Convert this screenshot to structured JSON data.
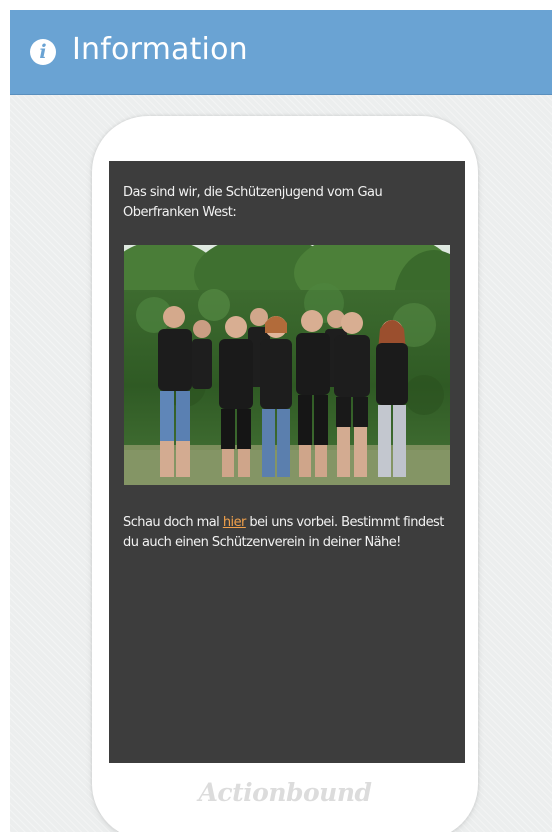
{
  "header": {
    "icon": "info-icon",
    "title": "Information",
    "color": "#6aa3d3"
  },
  "content": {
    "intro": "Das sind wir, die Schützenjugend vom Gau Oberfranken West:",
    "photo_icon": "group-photo",
    "outro_before": "Schau doch mal ",
    "link_label": "hier",
    "outro_after": " bei uns vorbei. Bestimmt findest du auch einen Schützenverein in deiner Nähe!",
    "link_color": "#f0a04b"
  },
  "footer": {
    "brand": "Actionbound"
  }
}
